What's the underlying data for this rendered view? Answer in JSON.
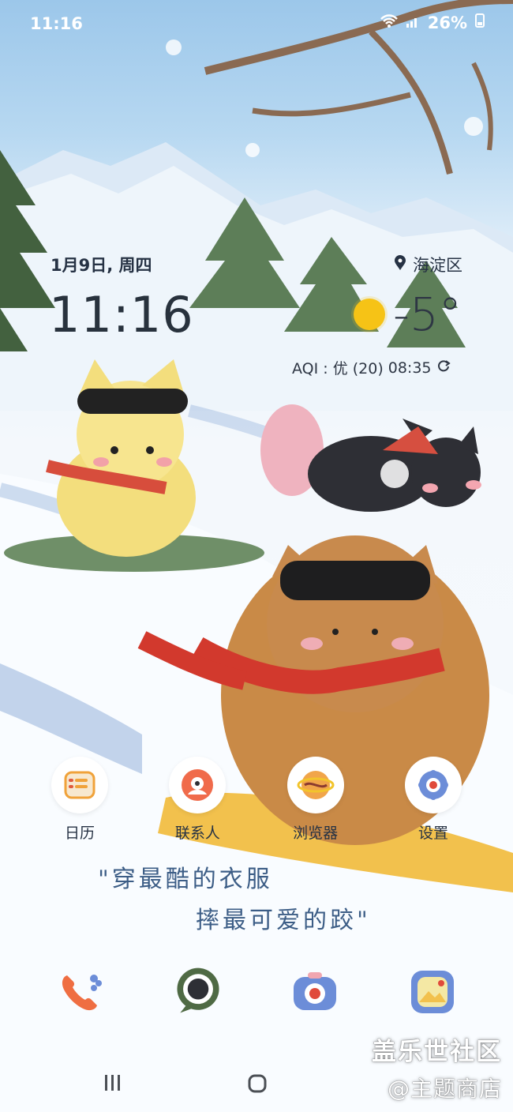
{
  "status_bar": {
    "time": "11:16",
    "battery": "26%"
  },
  "widget": {
    "date_prefix": "1月",
    "date_bold": "9",
    "date_suffix": "日, 周四",
    "clock": "11:16",
    "location": "海淀区",
    "temperature": "-5°",
    "aqi_label": "AQI : 优 (20)",
    "update_time": "08:35"
  },
  "apps": [
    {
      "label": "日历",
      "icon": "calendar-icon"
    },
    {
      "label": "联系人",
      "icon": "contacts-icon"
    },
    {
      "label": "浏览器",
      "icon": "browser-icon"
    },
    {
      "label": "设置",
      "icon": "settings-icon"
    }
  ],
  "quote": {
    "line1": "\"穿最酷的衣服",
    "line2": "摔最可爱的跤\""
  },
  "dock": [
    {
      "icon": "phone-icon"
    },
    {
      "icon": "messages-icon"
    },
    {
      "icon": "camera-icon"
    },
    {
      "icon": "gallery-icon"
    }
  ],
  "watermark": {
    "line1": "盖乐世社区",
    "line2": "@主题商店"
  },
  "colors": {
    "sky": "#9cc7ea",
    "snow": "#f7fbff",
    "sun": "#f6c316",
    "text_dark": "#263244",
    "quote_blue": "#3c5d86"
  }
}
